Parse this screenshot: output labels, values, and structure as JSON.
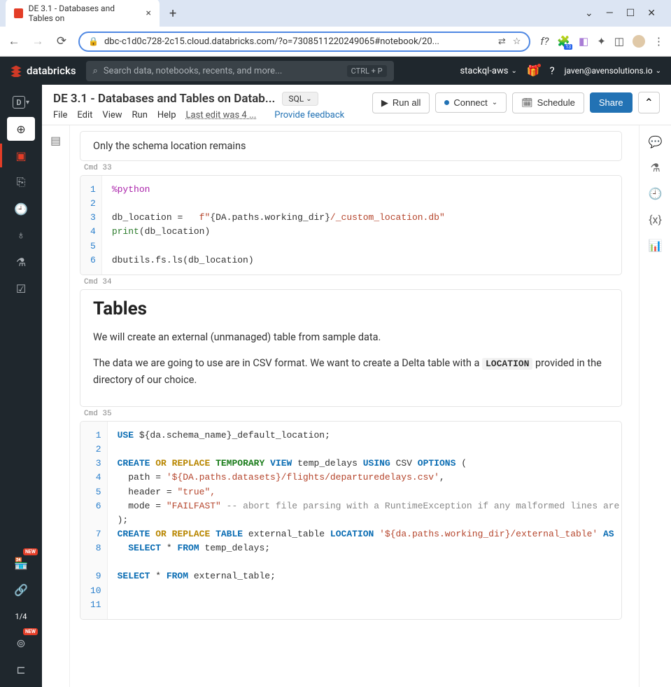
{
  "browser": {
    "tab_title": "DE 3.1 - Databases and Tables on",
    "url": "dbc-c1d0c728-2c15.cloud.databricks.com/?o=7308511220249065#notebook/20...",
    "ext_fn": "f?",
    "puzzle_count": "13"
  },
  "topbar": {
    "brand": "databricks",
    "search_placeholder": "Search data, notebooks, recents, and more...",
    "kbd_hint": "CTRL + P",
    "workspace": "stackql-aws",
    "user": "javen@avensolutions.io"
  },
  "left_rail": {
    "data_icon": "D",
    "count_label": "1/4"
  },
  "notebook": {
    "title": "DE 3.1 - Databases and Tables on Datab...",
    "lang": "SQL",
    "menu": {
      "file": "File",
      "edit": "Edit",
      "view": "View",
      "run": "Run",
      "help": "Help"
    },
    "last_edit": "Last edit was 4 ...",
    "feedback": "Provide feedback",
    "actions": {
      "run_all": "Run all",
      "connect": "Connect",
      "schedule": "Schedule",
      "share": "Share"
    }
  },
  "cells": {
    "cell32_text": "Only the schema location remains",
    "cmd33": "Cmd 33",
    "cmd34": "Cmd 34",
    "cmd35": "Cmd 35",
    "code33": {
      "lines": [
        "1",
        "2",
        "3",
        "4",
        "5",
        "6"
      ],
      "l1": "%python",
      "l2": "",
      "l3a": "db_location",
      "l3b": "=",
      "l3c": "f\"",
      "l3d": "{DA.paths.working_dir}",
      "l3e": "/_custom_location.db",
      "l3f": "\"",
      "l4a": "print",
      "l4b": "(",
      "l4c": "db_location",
      "l4d": ")",
      "l5": "",
      "l6a": "dbutils.fs.ls",
      "l6b": "(",
      "l6c": "db_location",
      "l6d": ")"
    },
    "md34": {
      "h2": "Tables",
      "p1": "We will create an external (unmanaged) table from sample data.",
      "p2a": "The data we are going to use are in CSV format. We want to create a Delta table with a ",
      "p2code": "LOCATION",
      "p2b": " provided in the directory of our choice."
    },
    "code35": {
      "lines": [
        "1",
        "2",
        "3",
        "4",
        "5",
        "6",
        "",
        "7",
        "8",
        "",
        "9",
        "10",
        "11"
      ],
      "l1_use": "USE",
      "l1_a": " $",
      "l1_b": "{da.schema_name}",
      "l1_c": "_default_location;",
      "l3_create": "CREATE",
      "l3_or": "OR",
      "l3_replace": "REPLACE",
      "l3_temp": "TEMPORARY",
      "l3_view": "VIEW",
      "l3_name": " temp_delays ",
      "l3_using": "USING",
      "l3_csv": " CSV ",
      "l3_options": "OPTIONS",
      "l3_paren": " (",
      "l4_path": "  path ",
      "l4_eq": "=",
      "l4_val": " '${DA.paths.datasets}/flights/departuredelays.csv'",
      "l4_c": ",",
      "l5_header": "  header ",
      "l5_eq": "=",
      "l5_val": " \"true\",",
      "l6_mode": "  mode ",
      "l6_eq": "=",
      "l6_val": " \"FAILFAST\"",
      "l6_cmt": " -- abort file parsing with a RuntimeException if any malformed lines are encountered",
      "l7": ");",
      "l8_create": "CREATE",
      "l8_or": "OR",
      "l8_replace": "REPLACE",
      "l8_table": "TABLE",
      "l8_name": " external_table ",
      "l8_loc": "LOCATION",
      "l8_val": " '${da.paths.working_dir}/external_table'",
      "l8_as": " AS",
      "l9_select": "  SELECT",
      "l9_star": " * ",
      "l9_from": "FROM",
      "l9_name": " temp_delays;",
      "l11_select": "SELECT",
      "l11_star": " * ",
      "l11_from": "FROM",
      "l11_name": " external_table;"
    }
  }
}
